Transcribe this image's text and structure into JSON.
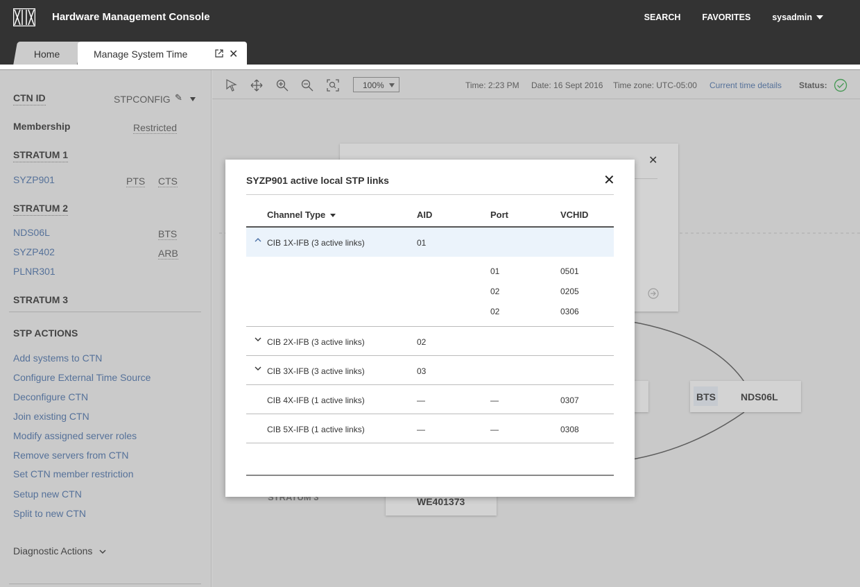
{
  "header": {
    "title": "Hardware Management Console",
    "search": "SEARCH",
    "favorites": "FAVORITES",
    "user": "sysadmin"
  },
  "tabs": {
    "home": "Home",
    "active": "Manage System Time"
  },
  "sidebar": {
    "ctn_id_label": "CTN ID",
    "ctn_id_value": "STPCONFIG",
    "membership_label": "Membership",
    "membership_value": "Restricted",
    "stratum1": "STRATUM 1",
    "s1_items": [
      {
        "name": "SYZP901",
        "role1": "PTS",
        "role2": "CTS"
      }
    ],
    "stratum2": "STRATUM 2",
    "s2_items": [
      {
        "name": "NDS06L",
        "role": "BTS"
      },
      {
        "name": "SYZP402",
        "role": "ARB"
      },
      {
        "name": "PLNR301",
        "role": ""
      }
    ],
    "stratum3": "STRATUM 3",
    "stp_actions": "STP ACTIONS",
    "actions": [
      "Add systems to CTN",
      "Configure External Time Source",
      "Deconfigure CTN",
      "Join existing CTN",
      "Modify assigned server roles",
      "Remove servers from CTN",
      "Set CTN member restriction",
      "Setup new CTN",
      "Split to new CTN"
    ],
    "diagnostic": "Diagnostic Actions"
  },
  "toolbar": {
    "zoom": "100%",
    "time": "Time: 2:23 PM",
    "date": "Date: 16 Sept 2016",
    "timezone": "Time zone: UTC-05:00",
    "details_link": "Current time details",
    "status_label": "Status:"
  },
  "canvas": {
    "node_bts": "BTS",
    "node_name": "NDS06L",
    "node_bottom": "WE401373",
    "stratum3_partial": "STRATUM 3"
  },
  "modal": {
    "title": "SYZP901 active local STP links",
    "columns": [
      "Channel Type",
      "AID",
      "Port",
      "VCHID"
    ],
    "rows": [
      {
        "type": "CIB 1X-IFB  (3 active links)",
        "aid": "01",
        "port": "",
        "vchid": "",
        "expanded": true
      },
      {
        "type": "",
        "aid": "",
        "port": "01",
        "vchid": "0501"
      },
      {
        "type": "",
        "aid": "",
        "port": "02",
        "vchid": "0205"
      },
      {
        "type": "",
        "aid": "",
        "port": "02",
        "vchid": "0306"
      },
      {
        "type": "CIB 2X-IFB  (3 active links)",
        "aid": "02",
        "port": "",
        "vchid": "",
        "expanded": false
      },
      {
        "type": "CIB 3X-IFB  (3 active links)",
        "aid": "03",
        "port": "",
        "vchid": "",
        "expanded": false
      },
      {
        "type": "CIB 4X-IFB  (1 active links)",
        "aid": "—",
        "port": "—",
        "vchid": "0307"
      },
      {
        "type": "CIB 5X-IFB  (1 active links)",
        "aid": "—",
        "port": "—",
        "vchid": "0308"
      }
    ]
  },
  "colors": {
    "header_bg": "#333333",
    "link": "#4a6fa5",
    "status_ok": "#3aa64c",
    "selected_row": "#ebf3fb"
  }
}
